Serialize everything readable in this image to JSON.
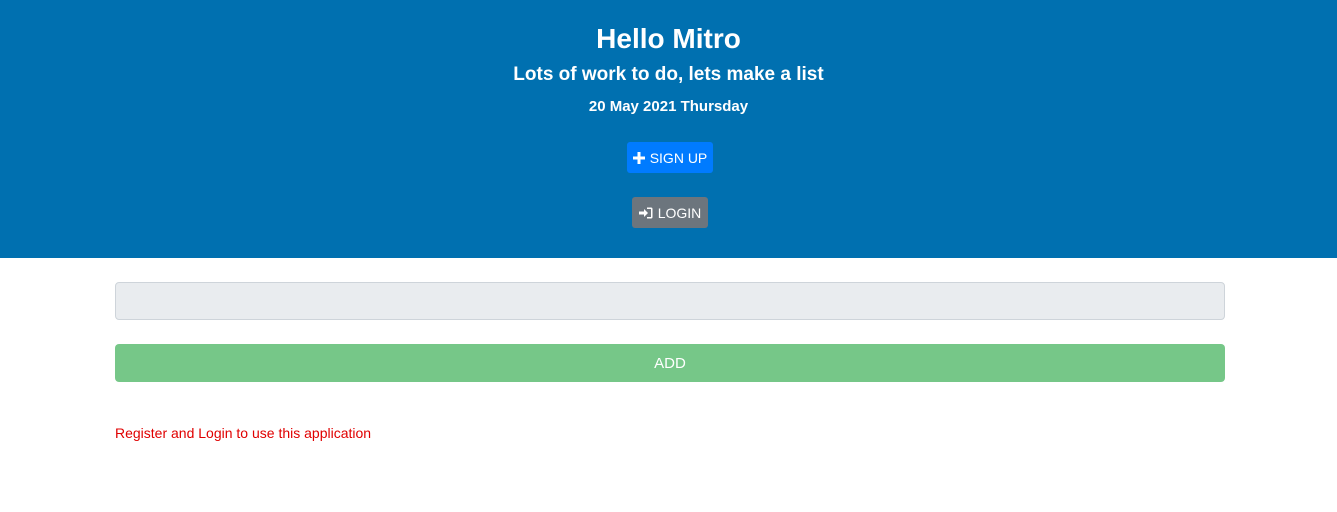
{
  "header": {
    "title": "Hello Mitro",
    "subtitle": "Lots of work to do, lets make a list",
    "date": "20 May 2021 Thursday",
    "signup_label": "SIGN UP",
    "signup_icon": "plus-icon",
    "login_label": "LOGIN",
    "login_icon": "sign-in-icon"
  },
  "main": {
    "task_input": {
      "value": "",
      "placeholder": ""
    },
    "add_label": "ADD",
    "notice": "Register and Login to use this application"
  },
  "colors": {
    "header_bg": "#0070b0",
    "signup_bg": "#007bff",
    "login_bg": "#6c757d",
    "add_bg": "#76c788",
    "notice_text": "#e00000"
  }
}
